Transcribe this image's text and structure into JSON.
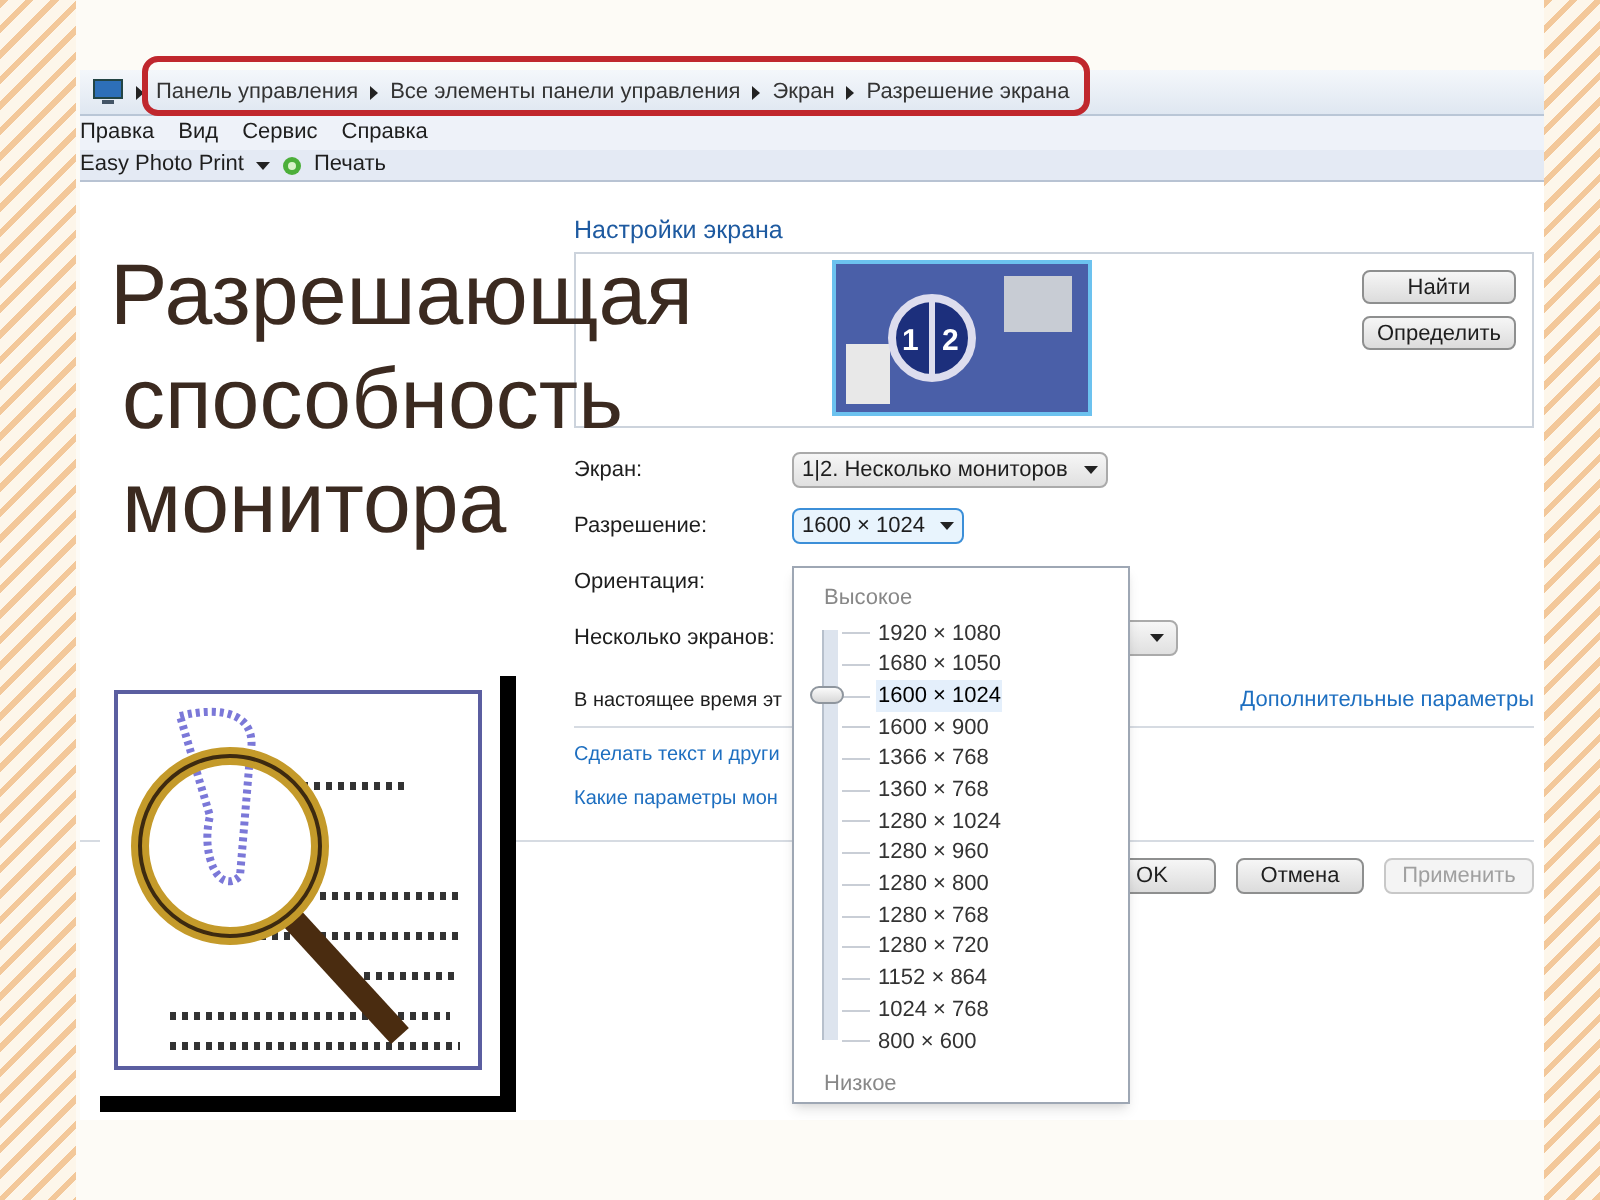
{
  "slide_title": [
    "Разрешающая",
    "способность",
    "монитора"
  ],
  "address_bar": {
    "crumbs": [
      "Панель управления",
      "Все элементы панели управления",
      "Экран",
      "Разрешение экрана"
    ]
  },
  "menu_bar": [
    "Правка",
    "Вид",
    "Сервис",
    "Справка"
  ],
  "toolbar": [
    {
      "label": "Easy Photo Print",
      "kind": "dropdown"
    },
    {
      "label": "Печать",
      "kind": "print"
    }
  ],
  "section_title": "Настройки экрана",
  "display_badge": [
    "1",
    "2"
  ],
  "monitor_buttons": [
    "Найти",
    "Определить"
  ],
  "fields": [
    {
      "label": "Экран:",
      "kind": "dropdown",
      "value": "1|2. Несколько мониторов",
      "focused": false
    },
    {
      "label": "Разрешение:",
      "kind": "dropdown",
      "value": "1600 × 1024",
      "focused": true
    },
    {
      "label": "Ориентация:",
      "kind": "label_only"
    },
    {
      "label": "Несколько экранов:",
      "kind": "covered_dropdown"
    }
  ],
  "status_text": "В настоящее время эт",
  "advanced_link": "Дополнительные параметры",
  "links": [
    "Сделать текст и други",
    "Какие параметры мон"
  ],
  "buttons": [
    {
      "label": "OK",
      "disabled": false
    },
    {
      "label": "Отмена",
      "disabled": false
    },
    {
      "label": "Применить",
      "disabled": true
    }
  ],
  "resolution_list": {
    "high_label": "Высокое",
    "low_label": "Низкое",
    "level": 0.846,
    "options": [
      {
        "label": "1920 × 1080",
        "selected": false
      },
      {
        "label": "1680 × 1050",
        "selected": false
      },
      {
        "label": "1600 × 1024",
        "selected": true
      },
      {
        "label": "1600 × 900",
        "selected": false
      },
      {
        "label": "1366 × 768",
        "selected": false
      },
      {
        "label": "1360 × 768",
        "selected": false
      },
      {
        "label": "1280 × 1024",
        "selected": false
      },
      {
        "label": "1280 × 960",
        "selected": false
      },
      {
        "label": "1280 × 800",
        "selected": false
      },
      {
        "label": "1280 × 768",
        "selected": false
      },
      {
        "label": "1280 × 720",
        "selected": false
      },
      {
        "label": "1152 × 864",
        "selected": false
      },
      {
        "label": "1024 × 768",
        "selected": false
      },
      {
        "label": "800 × 600",
        "selected": false
      }
    ]
  }
}
